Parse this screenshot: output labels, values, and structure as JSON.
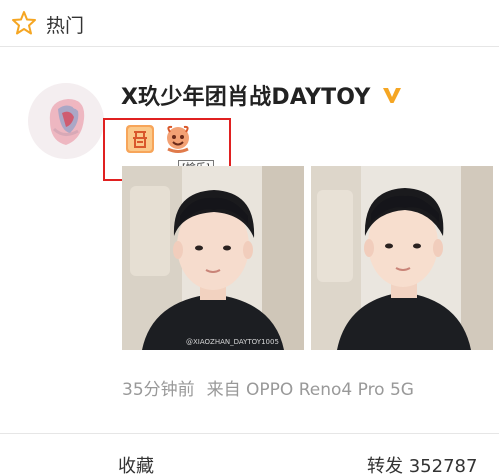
{
  "header": {
    "label": "热门"
  },
  "post": {
    "author": "X玖少年团肖战DAYTOY",
    "badge_tooltip": "[愉乐]",
    "timestamp": "35分钟前",
    "source": "来自 OPPO Reno4 Pro 5G",
    "photo_watermark": "@XIAOZHAN_DAYTOY1005"
  },
  "actions": {
    "collect_label": "收藏",
    "repost_label": "转发 352787"
  },
  "colors": {
    "accent_orange": "#f5a623",
    "highlight_red": "#e02020",
    "meta_gray": "#999999"
  },
  "icons": {
    "header": "star-icon",
    "verified": "verified-v-icon",
    "badges": [
      "zan-badge-icon",
      "yule-badge-icon"
    ]
  }
}
